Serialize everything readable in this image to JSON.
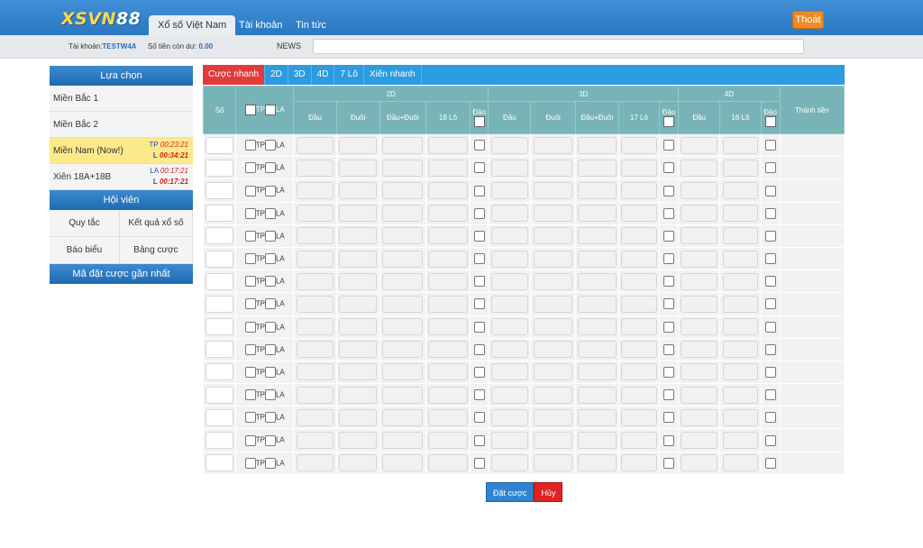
{
  "header": {
    "logo_left": "XSVN",
    "logo_right": "88",
    "nav": [
      "Xổ số Việt Nam",
      "Tài khoản",
      "Tin tức"
    ],
    "logout": "Thoát"
  },
  "info": {
    "account_label": "Tài khoản:",
    "account": "TESTW4A",
    "balance_label": "Số tiền còn dư:",
    "balance": "0.00",
    "news_label": "NEWS"
  },
  "sidebar": {
    "choices_title": "Lựa chọn",
    "items": [
      {
        "label": "Miền Bắc 1"
      },
      {
        "label": "Miền Bắc 2"
      },
      {
        "label": "Miền Nam (Now!)",
        "r1_prefix": "TP",
        "r1": "00:23:21",
        "r2_prefix": "L",
        "r2": "00:34:21"
      },
      {
        "label": "Xiên 18A+18B",
        "r1_prefix": "LA",
        "r1": "00:17:21",
        "r2_prefix": "L",
        "r2": "00:17:21"
      }
    ],
    "member_title": "Hội viên",
    "member_links": [
      "Quy tắc",
      "Kết quả xổ số",
      "Báo biểu",
      "Bảng cược"
    ],
    "recent_title": "Mã đặt cược gần nhất"
  },
  "tabs": [
    "Cược nhanh",
    "2D",
    "3D",
    "4D",
    "7 Lô",
    "Xiên nhanh"
  ],
  "table": {
    "col_so": "Số",
    "col_tp": "TP",
    "col_la": "LA",
    "group_2d": "2D",
    "group_3d": "3D",
    "group_4d": "4D",
    "col_total": "Thành tiền",
    "sub_2d": [
      "Đầu",
      "Đuôi",
      "Đầu+Đuôi",
      "18 Lô"
    ],
    "sub_3d": [
      "Đầu",
      "Đuôi",
      "Đầu+Đuôi",
      "17 Lô"
    ],
    "sub_4d": [
      "Đầu",
      "16 Lô"
    ],
    "dao": "Đảo",
    "row_count": 15
  },
  "buttons": {
    "submit": "Đặt cược",
    "cancel": "Hủy"
  }
}
